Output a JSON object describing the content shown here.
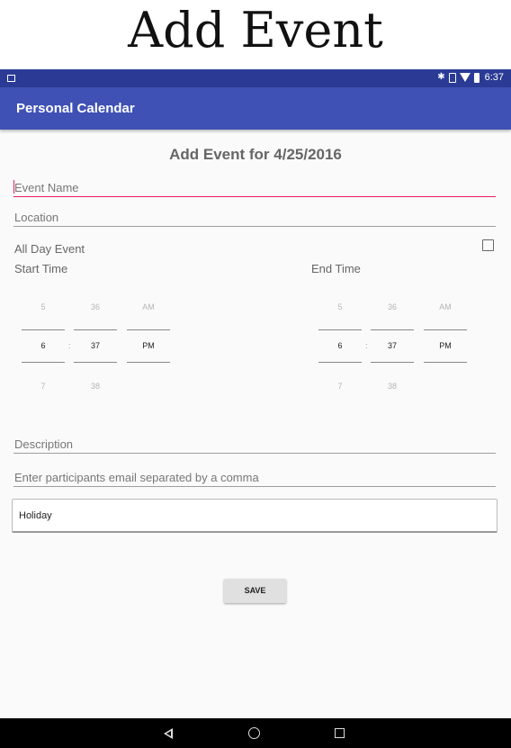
{
  "caption": "Add Event",
  "status_bar": {
    "time": "6:37"
  },
  "app_bar": {
    "title": "Personal Calendar"
  },
  "form": {
    "heading": "Add Event for 4/25/2016",
    "event_name_placeholder": "Event Name",
    "location_placeholder": "Location",
    "all_day_label": "All Day Event",
    "all_day_checked": false,
    "start_time_label": "Start Time",
    "end_time_label": "End Time",
    "start_time": {
      "hour": {
        "prev": "5",
        "selected": "6",
        "next": "7"
      },
      "minute": {
        "prev": "36",
        "selected": "37",
        "next": "38"
      },
      "ampm": {
        "prev": "AM",
        "selected": "PM"
      },
      "separator": ":"
    },
    "end_time": {
      "hour": {
        "prev": "5",
        "selected": "6",
        "next": "7"
      },
      "minute": {
        "prev": "36",
        "selected": "37",
        "next": "38"
      },
      "ampm": {
        "prev": "AM",
        "selected": "PM"
      },
      "separator": ":"
    },
    "description_placeholder": "Description",
    "participants_placeholder": "Enter participants email separated by a comma",
    "category_value": "Holiday",
    "save_label": "SAVE"
  }
}
